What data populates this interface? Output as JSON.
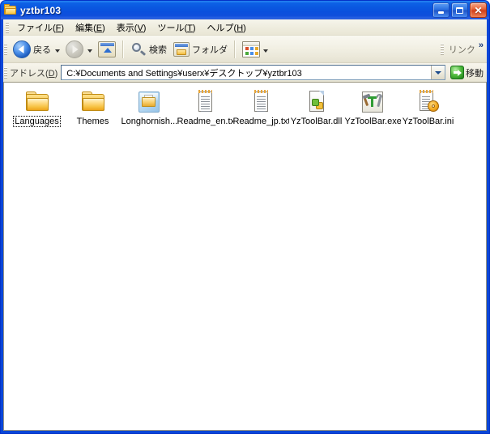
{
  "window": {
    "title": "yztbr103",
    "icon": "folder-icon",
    "controls": {
      "minimize": "minimize-button",
      "maximize": "maximize-button",
      "close": "close-button"
    }
  },
  "menu": {
    "items": [
      {
        "label": "ファイル(F)",
        "text": "ファイル(",
        "mnemonic": "F",
        "tail": ")"
      },
      {
        "label": "編集(E)",
        "text": "編集(",
        "mnemonic": "E",
        "tail": ")"
      },
      {
        "label": "表示(V)",
        "text": "表示(",
        "mnemonic": "V",
        "tail": ")"
      },
      {
        "label": "ツール(T)",
        "text": "ツール(",
        "mnemonic": "T",
        "tail": ")"
      },
      {
        "label": "ヘルプ(H)",
        "text": "ヘルプ(",
        "mnemonic": "H",
        "tail": ")"
      }
    ]
  },
  "toolbar": {
    "back_label": "戻る",
    "forward_label": "",
    "up_label": "",
    "search_label": "検索",
    "folders_label": "フォルダ",
    "views_label": "",
    "links_label": "リンク",
    "overflow_chevron": "»"
  },
  "address": {
    "label": "アドレス(D)",
    "label_text": "アドレス(",
    "label_mnemonic": "D",
    "label_tail": ")",
    "path": "C:¥Documents and Settings¥userx¥デスクトップ¥yztbr103",
    "go_label": "移動"
  },
  "files": [
    {
      "name": "Languages",
      "icon": "folder-icon",
      "type": "folder",
      "focused": true
    },
    {
      "name": "Themes",
      "icon": "folder-icon",
      "type": "folder",
      "focused": false
    },
    {
      "name": "Longhornish...",
      "icon": "compressed-folder-icon",
      "type": "zip",
      "focused": false
    },
    {
      "name": "Readme_en.txt",
      "icon": "text-file-icon",
      "type": "txt",
      "focused": false
    },
    {
      "name": "Readme_jp.txt",
      "icon": "text-file-icon",
      "type": "txt",
      "focused": false
    },
    {
      "name": "YzToolBar.dll",
      "icon": "dll-file-icon",
      "type": "dll",
      "focused": false
    },
    {
      "name": "YzToolBar.exe",
      "icon": "application-icon",
      "type": "exe",
      "focused": false
    },
    {
      "name": "YzToolBar.ini",
      "icon": "config-file-icon",
      "type": "ini",
      "focused": false
    }
  ],
  "colors": {
    "titlebar_blue": "#0a57e0",
    "window_border": "#0a46d8",
    "chrome_beige": "#f1efe2",
    "close_red": "#d1401a",
    "go_green": "#1e7d18",
    "folder_yellow": "#f6c245"
  }
}
